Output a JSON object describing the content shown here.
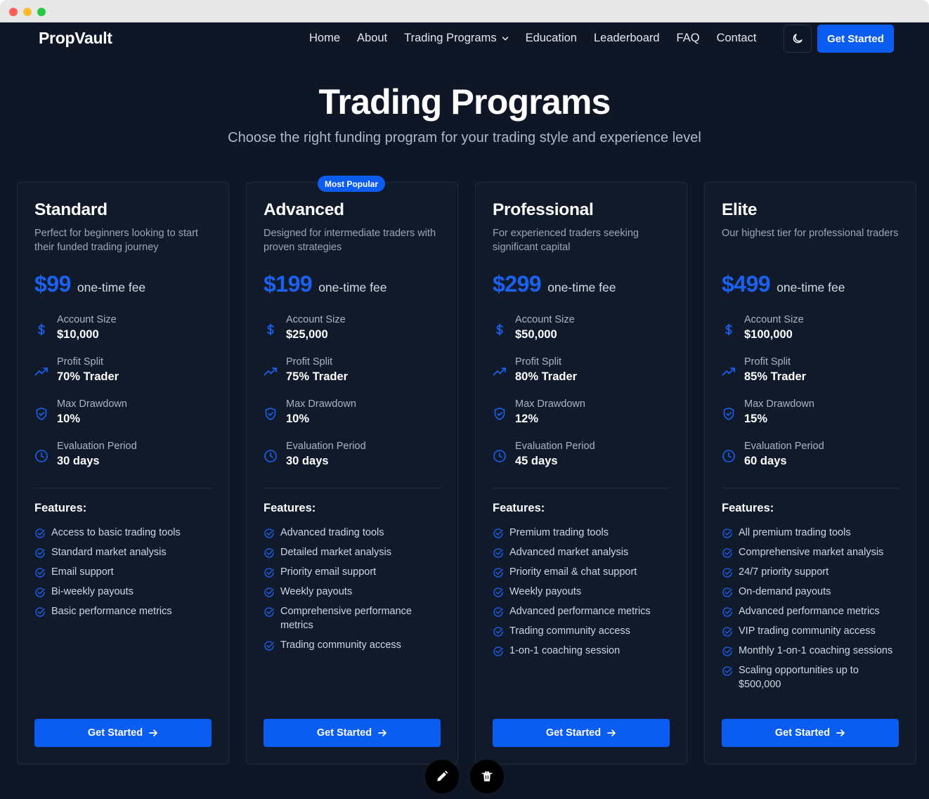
{
  "nav": {
    "brand": "PropVault",
    "links": [
      "Home",
      "About",
      "Trading Programs",
      "Education",
      "Leaderboard",
      "FAQ",
      "Contact"
    ],
    "theme_toggle_icon": "moon-icon",
    "cta": "Get Started"
  },
  "hero": {
    "title": "Trading Programs",
    "subtitle": "Choose the right funding program for your trading style and experience level"
  },
  "labels": {
    "account_size": "Account Size",
    "profit_split": "Profit Split",
    "max_drawdown": "Max Drawdown",
    "evaluation_period": "Evaluation Period",
    "features": "Features:",
    "fee_note": "one-time fee",
    "cta": "Get Started"
  },
  "plans": [
    {
      "name": "Standard",
      "description": "Perfect for beginners looking to start their funded trading journey",
      "price": "$99",
      "account_size": "$10,000",
      "profit_split": "70% Trader",
      "max_drawdown": "10%",
      "evaluation_period": "30 days",
      "features": [
        "Access to basic trading tools",
        "Standard market analysis",
        "Email support",
        "Bi-weekly payouts",
        "Basic performance metrics"
      ]
    },
    {
      "name": "Advanced",
      "badge": "Most Popular",
      "description": "Designed for intermediate traders with proven strategies",
      "price": "$199",
      "account_size": "$25,000",
      "profit_split": "75% Trader",
      "max_drawdown": "10%",
      "evaluation_period": "30 days",
      "features": [
        "Advanced trading tools",
        "Detailed market analysis",
        "Priority email support",
        "Weekly payouts",
        "Comprehensive performance metrics",
        "Trading community access"
      ]
    },
    {
      "name": "Professional",
      "description": "For experienced traders seeking significant capital",
      "price": "$299",
      "account_size": "$50,000",
      "profit_split": "80% Trader",
      "max_drawdown": "12%",
      "evaluation_period": "45 days",
      "features": [
        "Premium trading tools",
        "Advanced market analysis",
        "Priority email & chat support",
        "Weekly payouts",
        "Advanced performance metrics",
        "Trading community access",
        "1-on-1 coaching session"
      ]
    },
    {
      "name": "Elite",
      "description": "Our highest tier for professional traders",
      "price": "$499",
      "account_size": "$100,000",
      "profit_split": "85% Trader",
      "max_drawdown": "15%",
      "evaluation_period": "60 days",
      "features": [
        "All premium trading tools",
        "Comprehensive market analysis",
        "24/7 priority support",
        "On-demand payouts",
        "Advanced performance metrics",
        "VIP trading community access",
        "Monthly 1-on-1 coaching sessions",
        "Scaling opportunities up to $500,000"
      ]
    }
  ],
  "floating_actions": [
    "pencil-icon",
    "trash-icon"
  ],
  "colors": {
    "accent": "#0b5cf0",
    "background": "#0f1726",
    "card": "#111a2b"
  }
}
